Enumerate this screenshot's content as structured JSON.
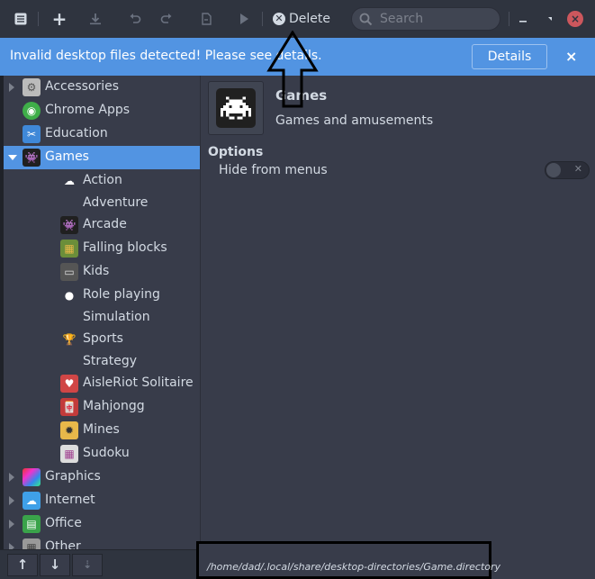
{
  "toolbar": {
    "delete_label": "Delete",
    "search_placeholder": "Search",
    "icons": [
      "menu-icon",
      "add-icon",
      "download-icon",
      "undo-icon",
      "redo-icon",
      "revert-icon",
      "run-icon",
      "minimize-icon",
      "maximize-icon",
      "close-icon"
    ]
  },
  "infobar": {
    "message": "Invalid desktop files detected! Please see details.",
    "details_label": "Details",
    "close_glyph": "×"
  },
  "sidebar": {
    "categories": [
      {
        "label": "Accessories",
        "icon": "accessories-icon",
        "level": 0,
        "expander": "closed"
      },
      {
        "label": "Chrome Apps",
        "icon": "chrome-apps-icon",
        "level": 0,
        "expander": "none"
      },
      {
        "label": "Education",
        "icon": "education-icon",
        "level": 0,
        "expander": "none"
      },
      {
        "label": "Games",
        "icon": "games-icon",
        "level": 0,
        "expander": "open",
        "selected": true
      },
      {
        "label": "Action",
        "icon": "action-icon",
        "level": 1
      },
      {
        "label": "Adventure",
        "icon": "",
        "level": 1
      },
      {
        "label": "Arcade",
        "icon": "arcade-icon",
        "level": 1
      },
      {
        "label": "Falling blocks",
        "icon": "falling-blocks-icon",
        "level": 1
      },
      {
        "label": "Kids",
        "icon": "kids-icon",
        "level": 1
      },
      {
        "label": "Role playing",
        "icon": "role-playing-icon",
        "level": 1
      },
      {
        "label": "Simulation",
        "icon": "",
        "level": 1
      },
      {
        "label": "Sports",
        "icon": "sports-icon",
        "level": 1
      },
      {
        "label": "Strategy",
        "icon": "",
        "level": 1
      },
      {
        "label": "AisleRiot Solitaire",
        "icon": "aisleriot-icon",
        "level": 1
      },
      {
        "label": "Mahjongg",
        "icon": "mahjongg-icon",
        "level": 1
      },
      {
        "label": "Mines",
        "icon": "mines-icon",
        "level": 1
      },
      {
        "label": "Sudoku",
        "icon": "sudoku-icon",
        "level": 1
      },
      {
        "label": "Graphics",
        "icon": "graphics-icon",
        "level": 0,
        "expander": "closed"
      },
      {
        "label": "Internet",
        "icon": "internet-icon",
        "level": 0,
        "expander": "closed"
      },
      {
        "label": "Office",
        "icon": "office-icon",
        "level": 0,
        "expander": "closed"
      },
      {
        "label": "Other",
        "icon": "other-icon",
        "level": 0,
        "expander": "closed"
      }
    ],
    "tools": [
      "move-up-icon",
      "move-down-icon",
      "move-down-disabled-icon"
    ]
  },
  "main": {
    "name": "Games",
    "comment": "Games and amusements",
    "options_heading": "Options",
    "hide_label": "Hide from menus",
    "hide_enabled": false
  },
  "pathbar": {
    "path": "/home/dad/.local/share/desktop-directories/Game.directory"
  },
  "colors": {
    "accent": "#5294e2",
    "window_bg": "#383c4a",
    "close": "#cc575d"
  }
}
